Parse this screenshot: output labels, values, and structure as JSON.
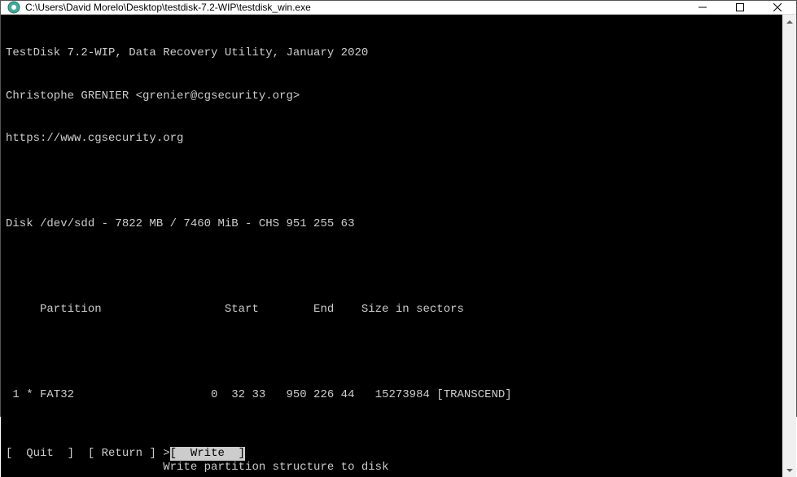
{
  "titlebar": {
    "title": "C:\\Users\\David Morelo\\Desktop\\testdisk-7.2-WIP\\testdisk_win.exe"
  },
  "terminal": {
    "header1": "TestDisk 7.2-WIP, Data Recovery Utility, January 2020",
    "header2": "Christophe GRENIER <grenier@cgsecurity.org>",
    "header3": "https://www.cgsecurity.org",
    "disk_line": "Disk /dev/sdd - 7822 MB / 7460 MiB - CHS 951 255 63",
    "table_header": "     Partition                  Start        End    Size in sectors",
    "partition_row": " 1 * FAT32                    0  32 33   950 226 44   15273984 [TRANSCEND]"
  },
  "menu": {
    "quit": "[  Quit  ]  ",
    "return": "[ Return ] ",
    "cursor": ">",
    "write": "[  Write  ]",
    "description": "                       Write partition structure to disk"
  }
}
